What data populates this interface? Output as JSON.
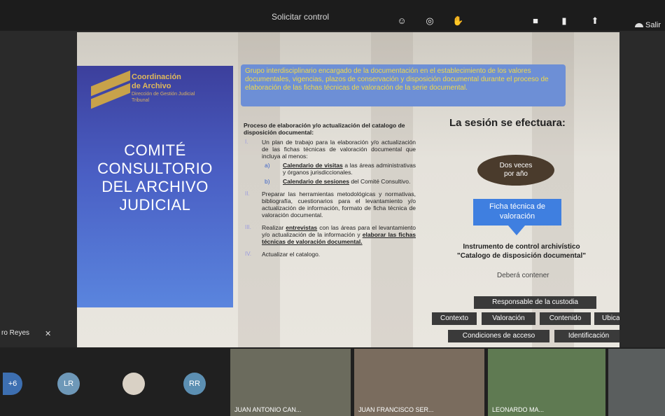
{
  "top_bar": {
    "title": "Solicitar control",
    "leave_label": "Salir"
  },
  "slide": {
    "logo_lines": [
      "Coordinación",
      "de Archivo",
      "Dirección de Gestión Judicial",
      "Tribunal"
    ],
    "committee_lines": [
      "COMITÉ",
      "CONSULTORIO",
      "DEL ARCHIVO",
      "JUDICIAL"
    ],
    "top_box": "Grupo interdisciplinario encargado de la documentación en el establecimiento de los valores documentales, vigencias, plazos de conservación y disposición documental durante el proceso de elaboración de las fichas técnicas de valoración de la serie documental.",
    "process_head": "Proceso de elaboración y/o actualización del catalogo de disposición documental:",
    "items": [
      {
        "num": "I.",
        "text": "Un plan de trabajo para la elaboración y/o actualización de las fichas técnicas de valoración documental que incluya al menos:"
      },
      {
        "num": "II.",
        "text": "Preparar las herramientas metodológicas y normativas, bibliografía, cuestionarios para el levantamiento y/o actualización de información, formato de ficha técnica de valoración documental."
      },
      {
        "num": "III.",
        "text_prefix": "Realizar ",
        "text_u1": "entrevistas",
        "text_mid": " con las áreas para el levantamiento y/o actualización de la información y ",
        "text_u2": "elaborar las fichas técnicas de valoración documental."
      },
      {
        "num": "IV.",
        "text": "Actualizar el catalogo."
      }
    ],
    "sub_items": [
      {
        "mark": "a)",
        "strong": "Calendario de visitas",
        "rest": " a las áreas administrativas y órganos jurisdiccionales."
      },
      {
        "mark": "b)",
        "strong": "Calendario de sesiones",
        "rest": " del Comité Consultivo."
      }
    ],
    "session_title": "La sesión se efectuara:",
    "oval_lines": [
      "Dos veces",
      "por año"
    ],
    "ficha_lines": [
      "Ficha técnica de",
      "valoración"
    ],
    "instrument_lines": [
      "Instrumento de control archivístico",
      "\"Catalogo de disposición documental\""
    ],
    "debera": "Deberá contener",
    "tags": [
      "Responsable de la custodia",
      "Contexto",
      "Valoración",
      "Contenido",
      "Ubicación",
      "Condiciones de acceso",
      "Identificación"
    ]
  },
  "presenter_label": "ro Reyes",
  "participants": {
    "more_count": "+6",
    "avatars": [
      "LR",
      "RR"
    ],
    "tiles": [
      "JUAN ANTONIO CAN...",
      "JUAN FRANCISCO SER...",
      "LEONARDO MA..."
    ]
  },
  "colors": {
    "left_panel": "#4a5fc4",
    "top_box": "#6d8fd6",
    "top_box_text": "#f1d94a",
    "ficha": "#3f7fe0",
    "oval": "#4a3b2c",
    "tag_bg": "#3a3a3a",
    "gold": "#c8a24a"
  },
  "icons": [
    "camera-icon",
    "mic-icon",
    "share-icon",
    "phone-icon",
    "reaction-icon",
    "hand-icon",
    "mic-off-icon"
  ]
}
